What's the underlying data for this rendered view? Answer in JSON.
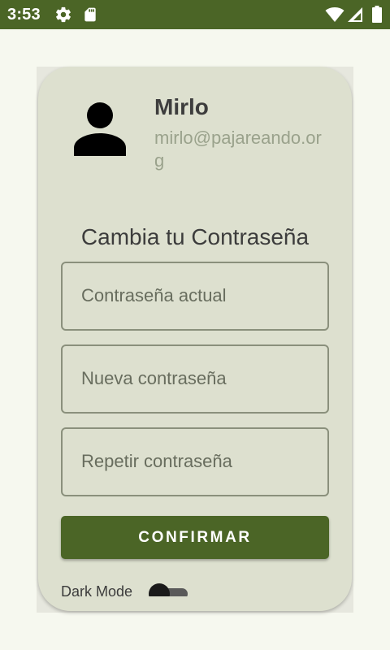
{
  "status_bar": {
    "time": "3:53",
    "icons": [
      "gear-icon",
      "sd-card-icon",
      "wifi-icon",
      "cell-signal-icon",
      "battery-icon"
    ],
    "background": "#4b6526"
  },
  "profile": {
    "name": "Mirlo",
    "email": "mirlo@pajareando.org",
    "avatar_icon": "person-icon"
  },
  "form": {
    "title": "Cambia tu Contraseña",
    "current_password_placeholder": "Contraseña actual",
    "new_password_placeholder": "Nueva contraseña",
    "repeat_password_placeholder": "Repetir contraseña",
    "confirm_label": "CONFIRMAR"
  },
  "settings": {
    "dark_mode_label": "Dark Mode",
    "dark_mode_enabled": false
  },
  "colors": {
    "accent": "#4b6526",
    "card_background": "#dde0cf",
    "page_background": "#f6f8ef"
  }
}
